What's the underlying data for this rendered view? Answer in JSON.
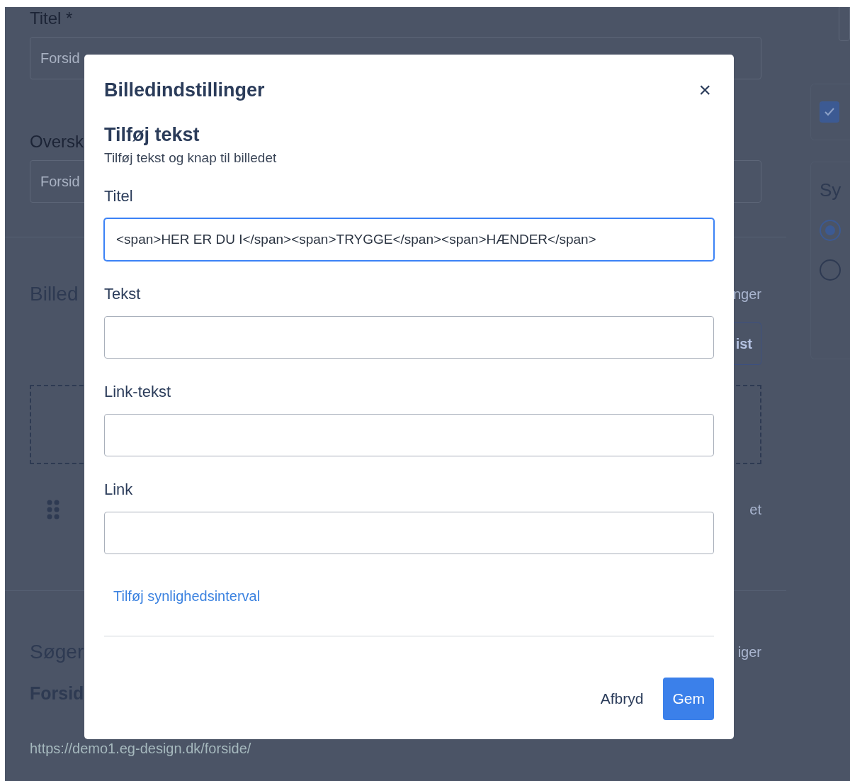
{
  "background": {
    "left": {
      "title_label": "Titel *",
      "title_value": "Forsid",
      "heading_label": "Oversk",
      "heading_value": "Forsid",
      "images_heading": "Billed",
      "images_action": "nger",
      "images_button": "ist",
      "image_row_action": "et",
      "seo_heading": "Søger",
      "seo_action": "iger",
      "seo_title": "Forsid",
      "seo_url": "https://demo1.eg-design.dk/forside/"
    },
    "right": {
      "checkbox_checked": true,
      "visibility_heading": "Sy",
      "radios": [
        {
          "selected": true
        },
        {
          "selected": false
        }
      ]
    }
  },
  "dialog": {
    "title": "Billedindstillinger",
    "close": "×",
    "section_title": "Tilføj tekst",
    "section_subtitle": "Tilføj tekst og knap til billedet",
    "fields": [
      {
        "label": "Titel",
        "value": "<span>HER ER DU I</span><span>TRYGGE</span><span>HÆNDER</span>",
        "focused": true
      },
      {
        "label": "Tekst",
        "focused": false
      },
      {
        "label": "Link-tekst",
        "focused": false
      },
      {
        "label": "Link",
        "focused": false
      }
    ],
    "interval_link": "Tilføj synlighedsinterval",
    "buttons": [
      {
        "label": "Afbryd",
        "kind": "secondary"
      },
      {
        "label": "Gem",
        "kind": "primary"
      }
    ]
  }
}
